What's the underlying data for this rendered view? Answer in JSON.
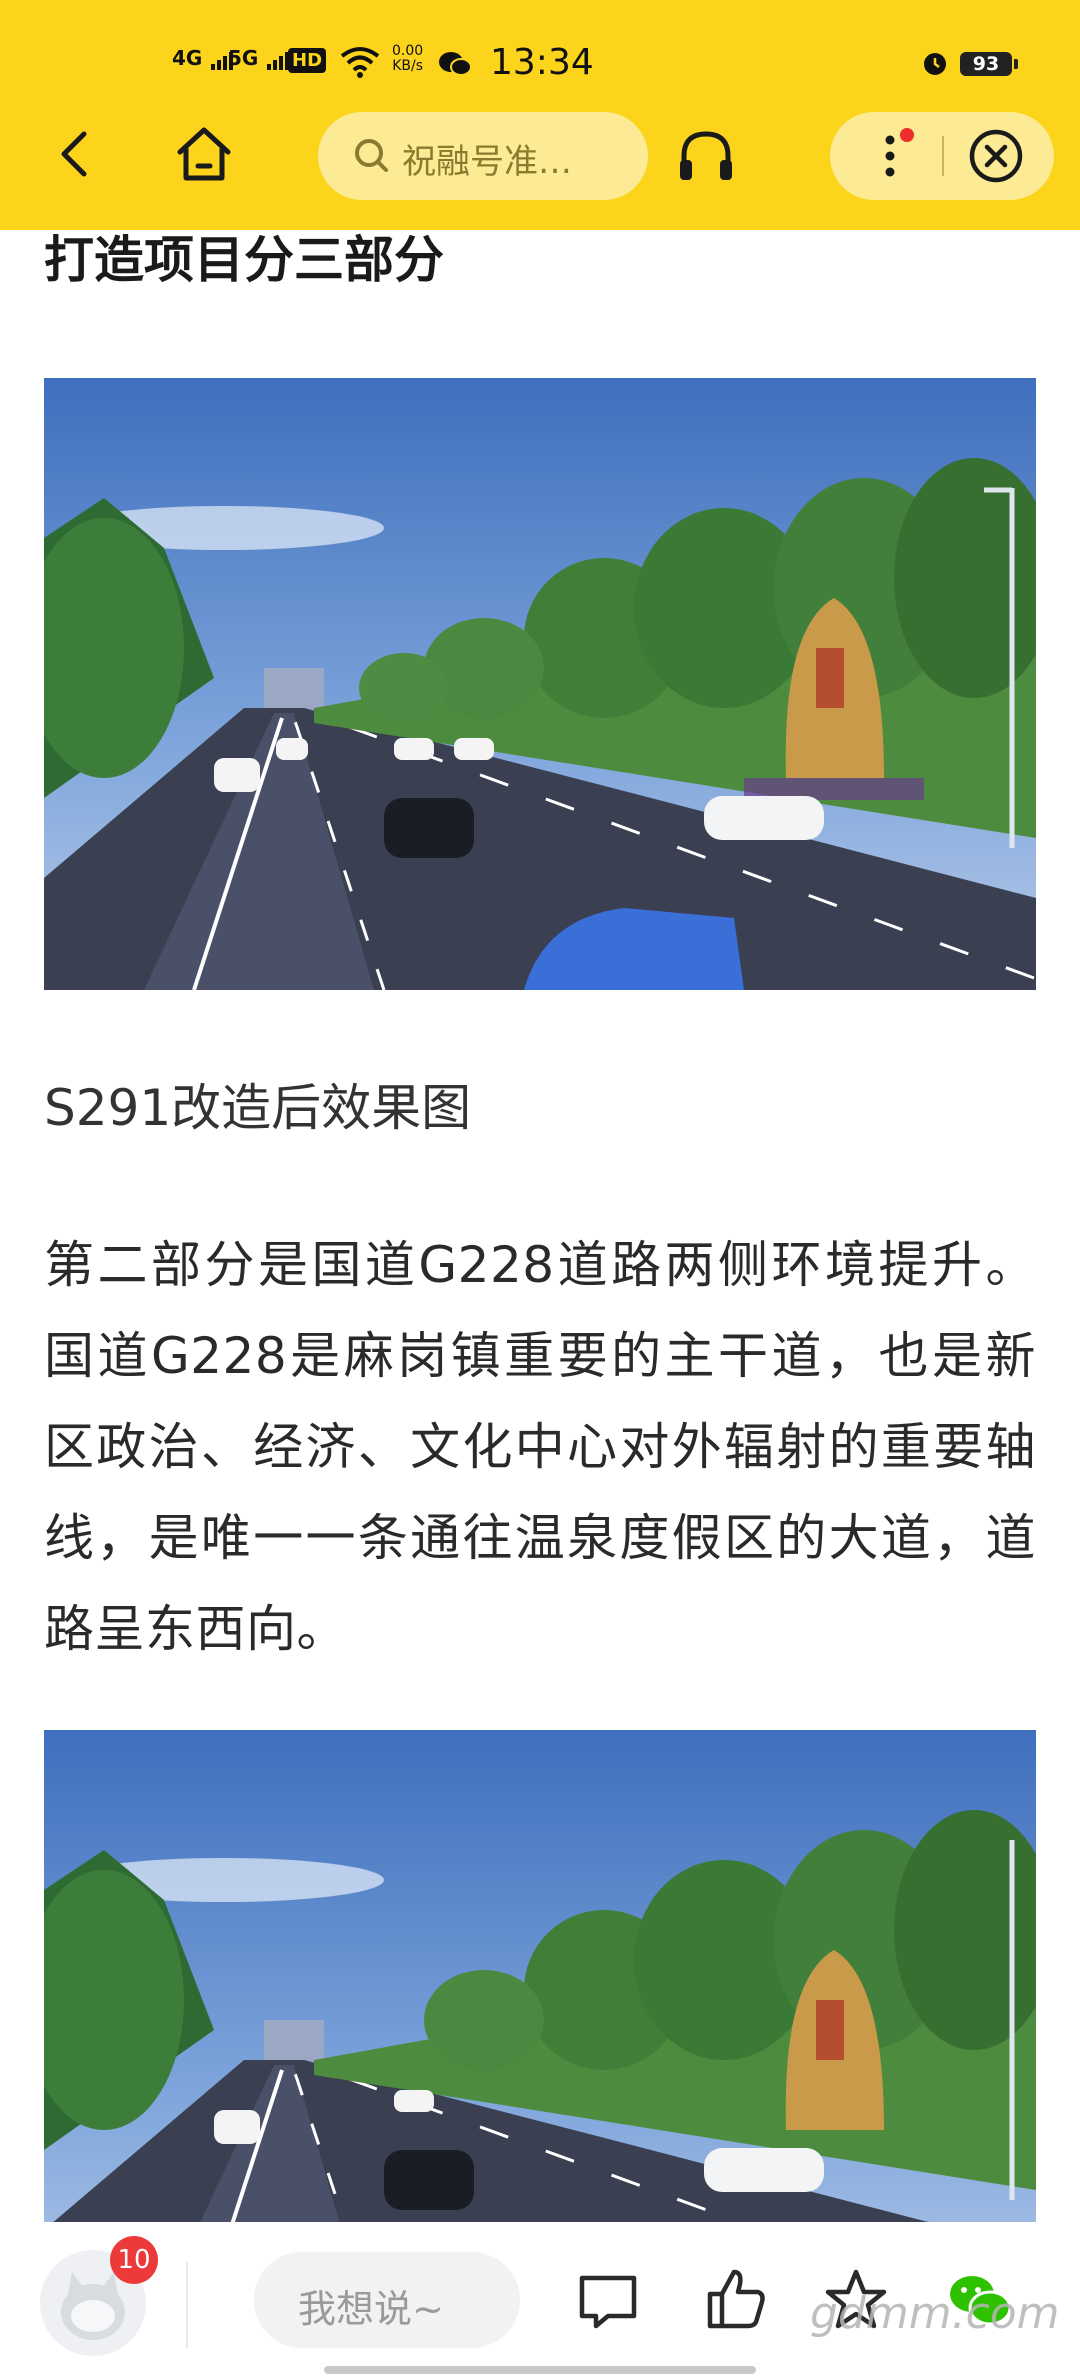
{
  "status_bar": {
    "net1": "4G",
    "net2": "5G",
    "hd": "HD",
    "speed_value": "0.00",
    "speed_unit": "KB/s",
    "time": "13:34",
    "battery": "93"
  },
  "nav": {
    "search_placeholder": "祝融号准…"
  },
  "article": {
    "section_title": "打造项目分三部分",
    "caption": "S291改造后效果图",
    "paragraph": "第二部分是国道G228道路两侧环境提升。国道G228是麻岗镇重要的主干道，也是新区政治、经济、文化中心对外辐射的重要轴线，是唯一一条通往温泉度假区的大道，道路呈东西向。"
  },
  "bottom_bar": {
    "badge_count": "10",
    "comment_placeholder": "我想说~",
    "watermark": "gdmm.com"
  },
  "colors": {
    "accent": "#fcd41c",
    "search_bg": "#fdea94",
    "badge": "#ec3a3a"
  },
  "icons": [
    "back-arrow-icon",
    "home-icon",
    "search-icon",
    "headphones-icon",
    "more-icon",
    "close-icon",
    "comment-icon",
    "thumbs-up-icon",
    "star-icon",
    "wechat-icon"
  ]
}
